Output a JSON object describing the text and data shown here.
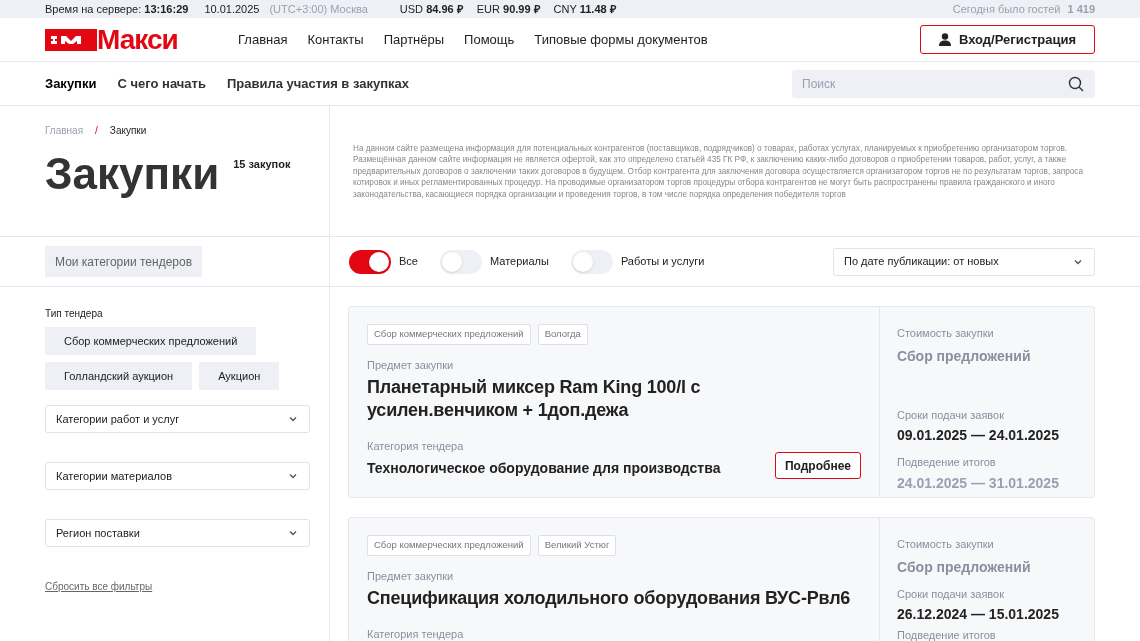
{
  "top_bar": {
    "server_time_label": "Время на сервере:",
    "server_time": "13:16:29",
    "date": "10.01.2025",
    "timezone": "(UTC+3:00) Москва",
    "currencies": [
      {
        "code": "USD",
        "value": "84.96 ₽"
      },
      {
        "code": "EUR",
        "value": "90.99 ₽"
      },
      {
        "code": "CNY",
        "value": "11.48 ₽"
      }
    ],
    "guests_label": "Сегодня было гостей",
    "guests": "1 419"
  },
  "header": {
    "logo_text": "Макси",
    "nav": [
      "Главная",
      "Контакты",
      "Партнёры",
      "Помощь",
      "Типовые формы документов"
    ],
    "login_button": "Вход/Регистрация"
  },
  "subnav": {
    "items": [
      {
        "label": "Закупки",
        "selected": true
      },
      {
        "label": "С чего начать",
        "selected": false
      },
      {
        "label": "Правила участия в закупках",
        "selected": false
      }
    ],
    "search": {
      "placeholder": "Поиск"
    }
  },
  "breadcrumbs": [
    "Главная",
    "Закупки"
  ],
  "breadcrumb_separator": "/",
  "page_title": "Закупки",
  "count": "15 закупок",
  "disclaimer": "На данном сайте размещена информация для потенциальных контрагентов (поставщиков, подрядчиков) о товарах, работах услугах, планируемых к приобретению организатором торгов. Размещённая данном сайте информация не является офертой, как это определено статьёй 435 ГК РФ, к заключению каких-либо договоров о приобретении товаров, работ, услуг, а также предварительных договоров о заключении таких договоров в будущем. Отбор контрагента для заключения договора осуществляется организатором торгов не по результатам торгов, запроса котировок и иных регламентированных процедур. На проводимые организатором торгов процедуры отбора контрагентов не могут быть распространены правила гражданского и иного законодательства, касающиеся порядка организации и проведения торгов, в том числе порядка определения победителя торгов",
  "my_categories_button": "Мои категории тендеров",
  "toggles": [
    {
      "label": "Все",
      "on": true
    },
    {
      "label": "Материалы",
      "on": false
    },
    {
      "label": "Работы и услуги",
      "on": false
    }
  ],
  "sort": {
    "value": "По дате публикации: от новых"
  },
  "filters": {
    "tender_type_label": "Тип тендера",
    "tender_types": [
      "Сбор коммерческих предложений",
      "Голландский аукцион",
      "Аукцион"
    ],
    "dropdowns": [
      "Категории работ и услуг",
      "Категории материалов",
      "Регион поставки"
    ],
    "reset_link": "Сбросить все фильтры"
  },
  "cards": [
    {
      "tags": [
        "Сбор коммерческих предложений",
        "Вологда"
      ],
      "subject_label": "Предмет закупки",
      "subject": "Планетарный миксер Ram King 100/l с усилен.венчиком + 1доп.дежа",
      "category_label": "Категория тендера",
      "category": "Технологическое оборудование для производства",
      "button": "Подробнее",
      "cost_label": "Стоимость закупки",
      "cost": "Сбор предложений",
      "deadline_label": "Сроки подачи заявок",
      "deadline": "09.01.2025 — 24.01.2025",
      "results_label": "Подведение итогов",
      "results": "24.01.2025 — 31.01.2025"
    },
    {
      "tags": [
        "Сбор коммерческих предложений",
        "Великий Устюг"
      ],
      "subject_label": "Предмет закупки",
      "subject": "Спецификация холодильного оборудования ВУС-Рвл6",
      "category_label": "Категория тендера",
      "cost_label": "Стоимость закупки",
      "cost": "Сбор предложений",
      "deadline_label": "Сроки подачи заявок",
      "deadline": "26.12.2024 — 15.01.2025",
      "results_label": "Подведение итогов"
    }
  ]
}
